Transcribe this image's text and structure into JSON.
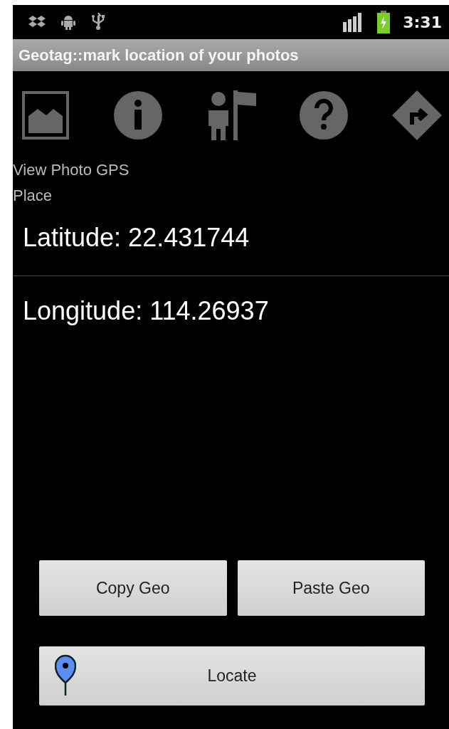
{
  "status_bar": {
    "time": "3:31"
  },
  "title": "Geotag::mark location of your photos",
  "caption": [
    "View Photo GPS",
    "Place"
  ],
  "fields": [
    {
      "text": "Latitude: 22.431744"
    },
    {
      "text": "Longitude: 114.26937"
    }
  ],
  "buttons": [
    {
      "label": "Copy Geo"
    },
    {
      "label": "Paste Geo"
    }
  ],
  "locate_button": {
    "label": "Locate"
  }
}
